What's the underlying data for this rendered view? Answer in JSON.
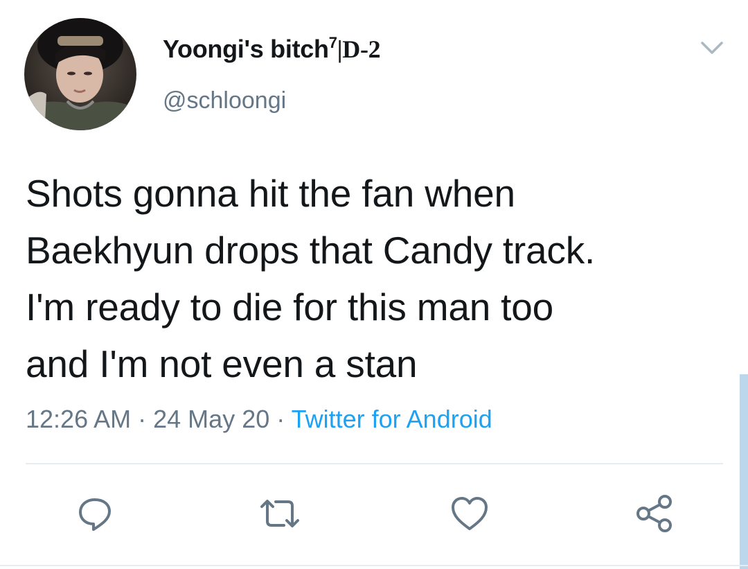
{
  "tweet": {
    "author": {
      "name": "Yoongi's bitch",
      "name_superscript": "7",
      "name_suffix": "|D-2",
      "handle": "@schloongi",
      "avatar": "profile-photo"
    },
    "text_lines": [
      "Shots gonna hit the fan when",
      "Baekhyun drops that Candy track.",
      "I'm ready to die for this man too",
      "and I'm not even a stan"
    ],
    "time": "12:26 AM",
    "separator": "·",
    "date": "24 May 20",
    "source": "Twitter for Android"
  },
  "icons": {
    "menu": "chevron-down-icon",
    "reply": "reply-icon",
    "retweet": "retweet-icon",
    "like": "heart-icon",
    "share": "share-icon"
  },
  "colors": {
    "text": "#14171a",
    "secondary": "#657786",
    "accent": "#1da1f2",
    "divider": "#e6ecf0"
  }
}
